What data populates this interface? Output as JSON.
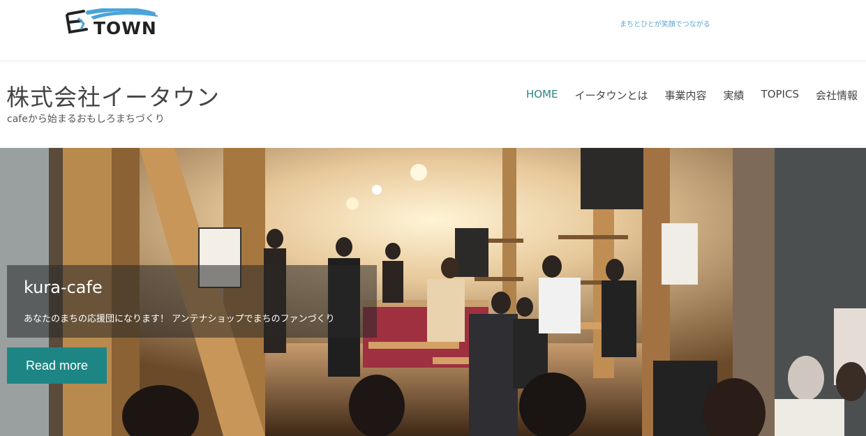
{
  "brand": {
    "logo_text": "TOWN",
    "tagline": "まちとひとが笑顔でつながる"
  },
  "site": {
    "title": "株式会社イータウン",
    "description": "cafeから始まるおもしろまちづくり"
  },
  "nav": {
    "items": [
      {
        "label": "HOME",
        "active": true
      },
      {
        "label": "イータウンとは",
        "active": false
      },
      {
        "label": "事業内容",
        "active": false
      },
      {
        "label": "実績",
        "active": false
      },
      {
        "label": "TOPICS",
        "active": false
      },
      {
        "label": "会社情報",
        "active": false
      }
    ]
  },
  "hero": {
    "title": "kura-cafe",
    "text": "あなたのまちの応援団になります！ アンテナショップでまちのファンづくり",
    "button_label": "Read more"
  },
  "colors": {
    "accent": "#1e8585",
    "nav_active": "#2a8585",
    "tagline": "#5aa5d6",
    "logo_swoosh": "#4aa3d9"
  }
}
